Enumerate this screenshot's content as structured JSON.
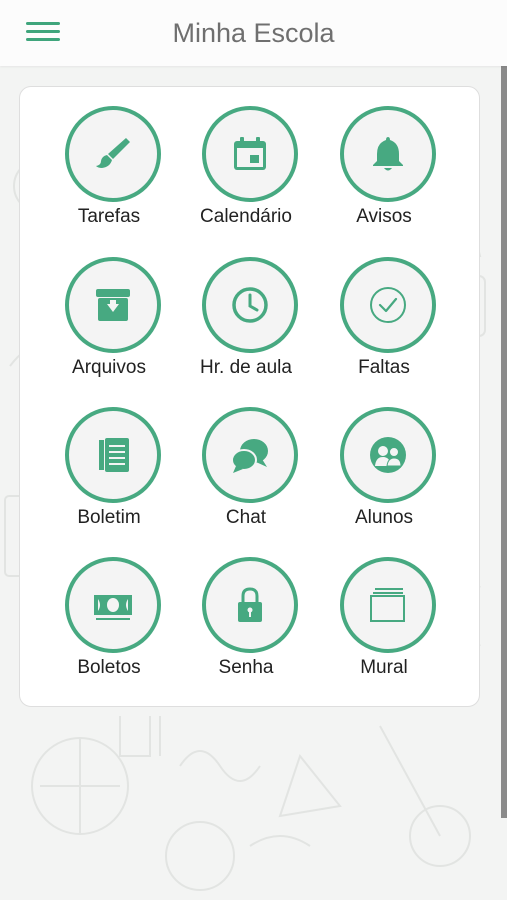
{
  "header": {
    "title": "Minha Escola",
    "menu_icon": "hamburger-menu-icon"
  },
  "colors": {
    "accent": "#47a981",
    "tile_background": "#f4f4f4",
    "title_text": "#6f6f6f"
  },
  "menu": {
    "items": [
      {
        "label": "Tarefas",
        "icon": "paintbrush-icon"
      },
      {
        "label": "Calendário",
        "icon": "calendar-icon"
      },
      {
        "label": "Avisos",
        "icon": "bell-icon"
      },
      {
        "label": "Arquivos",
        "icon": "archive-box-icon"
      },
      {
        "label": "Hr. de aula",
        "icon": "clock-icon"
      },
      {
        "label": "Faltas",
        "icon": "check-circle-icon"
      },
      {
        "label": "Boletim",
        "icon": "report-card-icon"
      },
      {
        "label": "Chat",
        "icon": "chat-bubbles-icon"
      },
      {
        "label": "Alunos",
        "icon": "students-icon"
      },
      {
        "label": "Boletos",
        "icon": "banknote-icon"
      },
      {
        "label": "Senha",
        "icon": "padlock-icon"
      },
      {
        "label": "Mural",
        "icon": "stacked-boards-icon"
      }
    ]
  }
}
